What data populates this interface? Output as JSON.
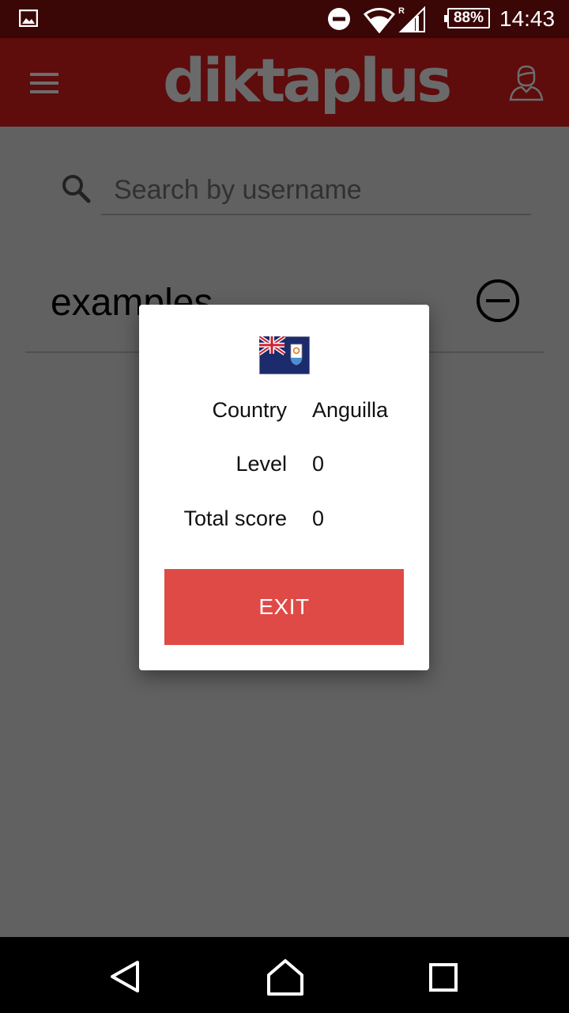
{
  "status_bar": {
    "battery": "88%",
    "time": "14:43",
    "signal_label": "R"
  },
  "app_bar": {
    "logo_text": "diktaplus",
    "menu_icon": "hamburger-menu-icon",
    "profile_icon": "user-profile-icon"
  },
  "search": {
    "placeholder": "Search by username",
    "value": ""
  },
  "list": {
    "items": [
      {
        "title": "examples",
        "action_icon": "remove-circle-icon"
      }
    ]
  },
  "dialog": {
    "flag_icon": "flag-anguilla-icon",
    "rows": [
      {
        "label": "Country",
        "value": "Anguilla"
      },
      {
        "label": "Level",
        "value": "0"
      },
      {
        "label": "Total score",
        "value": "0"
      }
    ],
    "exit_label": "EXIT"
  },
  "colors": {
    "status_bar": "#3a0606",
    "app_bar": "#5e0c0c",
    "exit_button": "#df4a47",
    "logo": "#6a6a6a"
  }
}
